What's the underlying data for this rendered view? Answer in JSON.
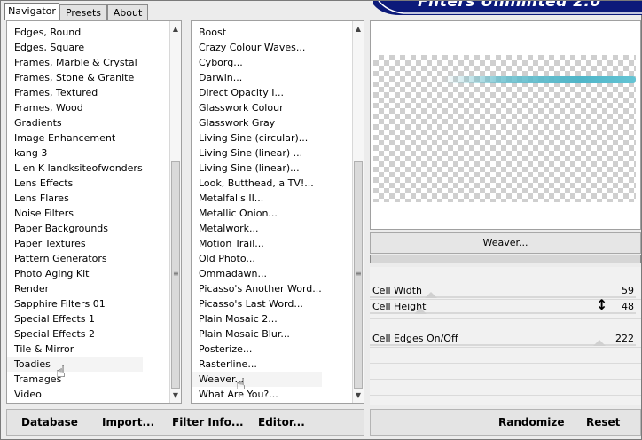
{
  "tabs": [
    {
      "label": "Navigator",
      "active": true
    },
    {
      "label": "Presets",
      "active": false
    },
    {
      "label": "About",
      "active": false
    }
  ],
  "banner": {
    "title": "Filters Unlimited 2.0",
    "color": "#0c1a7a"
  },
  "categories": {
    "items": [
      "Edges, Round",
      "Edges, Square",
      "Frames, Marble & Crystal",
      "Frames, Stone & Granite",
      "Frames, Textured",
      "Frames, Wood",
      "Gradients",
      "Image Enhancement",
      "kang 3",
      "L en K landksiteofwonders",
      "Lens Effects",
      "Lens Flares",
      "Noise Filters",
      "Paper Backgrounds",
      "Paper Textures",
      "Pattern Generators",
      "Photo Aging Kit",
      "Render",
      "Sapphire Filters 01",
      "Special Effects 1",
      "Special Effects 2",
      "Tile & Mirror",
      "Toadies",
      "Tramages",
      "Video"
    ],
    "selected": "Toadies"
  },
  "filters": {
    "items": [
      "Boost",
      "Crazy Colour Waves...",
      "Cyborg...",
      "Darwin...",
      "Direct Opacity I...",
      "Glasswork Colour",
      "Glasswork Gray",
      "Living Sine (circular)...",
      "Living Sine (linear) ...",
      "Living Sine (linear)...",
      "Look, Butthead, a TV!...",
      "Metalfalls II...",
      "Metallic Onion...",
      "Metalwork...",
      "Motion Trail...",
      "Old Photo...",
      "Ommadawn...",
      "Picasso's Another Word...",
      "Picasso's Last Word...",
      "Plain Mosaic 2...",
      "Plain Mosaic Blur...",
      "Posterize...",
      "Rasterline...",
      "Weaver...",
      "What Are You?..."
    ],
    "selected": "Weaver..."
  },
  "preview": {
    "accent": "#4fb5c8"
  },
  "current_filter": "Weaver...",
  "params": [
    {
      "label": "Cell Width",
      "value": "59"
    },
    {
      "label": "Cell Height",
      "value": "48"
    },
    {
      "label": "Cell Edges On/Off",
      "value": "222"
    }
  ],
  "buttons": {
    "database": "Database",
    "import": "Import...",
    "filter_info": "Filter Info...",
    "editor": "Editor...",
    "randomize": "Randomize",
    "reset": "Reset"
  }
}
